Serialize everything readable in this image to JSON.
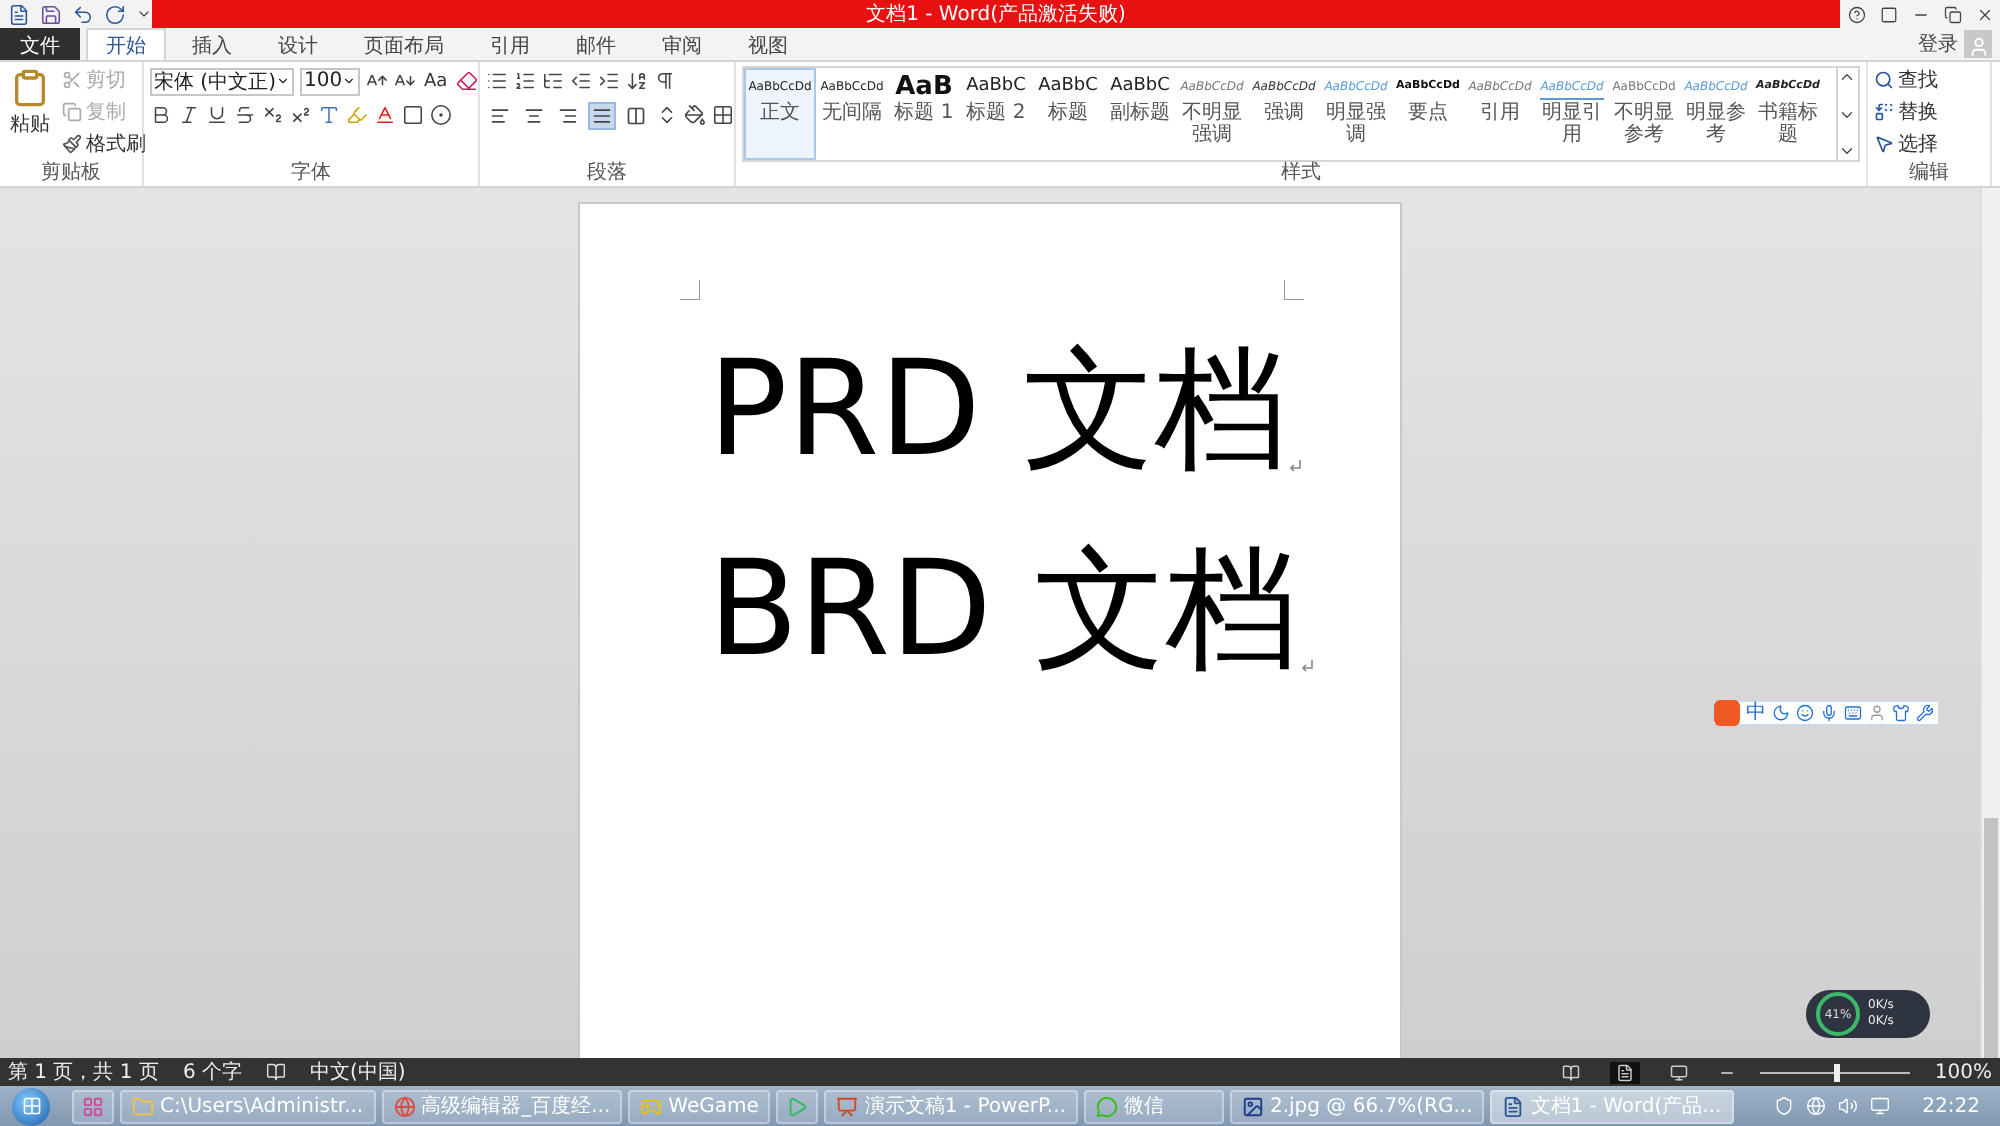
{
  "title": "文档1 - Word(产品激活失败)",
  "tabs": [
    {
      "label": "文件",
      "kind": "file",
      "selected": false
    },
    {
      "label": "开始",
      "kind": "tab",
      "selected": true
    },
    {
      "label": "插入",
      "kind": "tab",
      "selected": false
    },
    {
      "label": "设计",
      "kind": "tab",
      "selected": false
    },
    {
      "label": "页面布局",
      "kind": "tab",
      "selected": false
    },
    {
      "label": "引用",
      "kind": "tab",
      "selected": false
    },
    {
      "label": "邮件",
      "kind": "tab",
      "selected": false
    },
    {
      "label": "审阅",
      "kind": "tab",
      "selected": false
    },
    {
      "label": "视图",
      "kind": "tab",
      "selected": false
    }
  ],
  "account": {
    "label": "登录"
  },
  "ribbon": {
    "clipboard": {
      "label": "剪贴板",
      "paste": "粘贴",
      "items": [
        {
          "label": "剪切",
          "kind": "cut",
          "disabled": true
        },
        {
          "label": "复制",
          "kind": "copy",
          "disabled": true
        },
        {
          "label": "格式刷",
          "kind": "painter",
          "disabled": false
        }
      ]
    },
    "font": {
      "label": "字体",
      "font_name": "宋体 (中文正)",
      "font_size": "100",
      "case_button": "Aa"
    },
    "paragraph": {
      "label": "段落",
      "align_buttons": [
        {
          "kind": "left",
          "selected": false
        },
        {
          "kind": "center",
          "selected": false
        },
        {
          "kind": "right",
          "selected": false
        },
        {
          "kind": "justify",
          "selected": true
        },
        {
          "kind": "distributed",
          "selected": false
        }
      ]
    },
    "styles": {
      "label": "样式",
      "items": [
        {
          "preview": "AaBbCcDd",
          "label": "正文",
          "kind": "normal",
          "selected": true
        },
        {
          "preview": "AaBbCcDd",
          "label": "无间隔",
          "kind": "normal",
          "selected": false
        },
        {
          "preview": "AaB",
          "label": "标题 1",
          "kind": "heading1",
          "selected": false
        },
        {
          "preview": "AaBbC",
          "label": "标题 2",
          "kind": "heading2",
          "selected": false
        },
        {
          "preview": "AaBbC",
          "label": "标题",
          "kind": "heading2",
          "selected": false
        },
        {
          "preview": "AaBbC",
          "label": "副标题",
          "kind": "heading2",
          "selected": false
        },
        {
          "preview": "AaBbCcDd",
          "label": "不明显强调",
          "kind": "subtle",
          "selected": false
        },
        {
          "preview": "AaBbCcDd",
          "label": "强调",
          "kind": "emphasis",
          "selected": false
        },
        {
          "preview": "AaBbCcDd",
          "label": "明显强调",
          "kind": "intense",
          "selected": false
        },
        {
          "preview": "AaBbCcDd",
          "label": "要点",
          "kind": "strong",
          "selected": false
        },
        {
          "preview": "AaBbCcDd",
          "label": "引用",
          "kind": "subtle",
          "selected": false
        },
        {
          "preview": "AaBbCcDd",
          "label": "明显引用",
          "kind": "intense-quote",
          "selected": false
        },
        {
          "preview": "AaBbCcDd",
          "label": "不明显参考",
          "kind": "reference",
          "selected": false
        },
        {
          "preview": "AaBbCcDd",
          "label": "明显参考",
          "kind": "intense",
          "selected": false
        },
        {
          "preview": "AaBbCcDd",
          "label": "书籍标题",
          "kind": "book",
          "selected": false
        }
      ]
    },
    "editing": {
      "label": "编辑",
      "items": [
        {
          "label": "查找",
          "kind": "find"
        },
        {
          "label": "替换",
          "kind": "replace"
        },
        {
          "label": "选择",
          "kind": "select"
        }
      ]
    }
  },
  "document": {
    "lines": [
      "PRD 文档",
      "BRD 文档"
    ]
  },
  "ime_bar": {
    "mode": "中"
  },
  "net_meter": {
    "percent": "41%",
    "upload": "0K/s",
    "download": "0K/s"
  },
  "status_bar": {
    "page": "第 1 页，共 1 页",
    "words": "6 个字",
    "language": "中文(中国)",
    "zoom": "100%",
    "zoom_slider": {
      "level": 0.5
    }
  },
  "taskbar": {
    "items": [
      {
        "kind": "app",
        "selected": false
      },
      {
        "label": "C:\\Users\\Administr...",
        "kind": "folder",
        "selected": false
      },
      {
        "label": "高级编辑器_百度经...",
        "kind": "browser",
        "selected": false
      },
      {
        "label": "WeGame",
        "kind": "game",
        "selected": false
      },
      {
        "kind": "player",
        "selected": false
      },
      {
        "label": "演示文稿1 - PowerP...",
        "kind": "slides",
        "selected": false
      },
      {
        "label": "微信",
        "kind": "chat",
        "selected": false
      },
      {
        "label": "2.jpg @ 66.7%(RG...",
        "kind": "photo",
        "selected": false
      },
      {
        "label": "文档1 - Word(产品...",
        "kind": "word",
        "selected": true
      }
    ],
    "clock": "22:22"
  }
}
